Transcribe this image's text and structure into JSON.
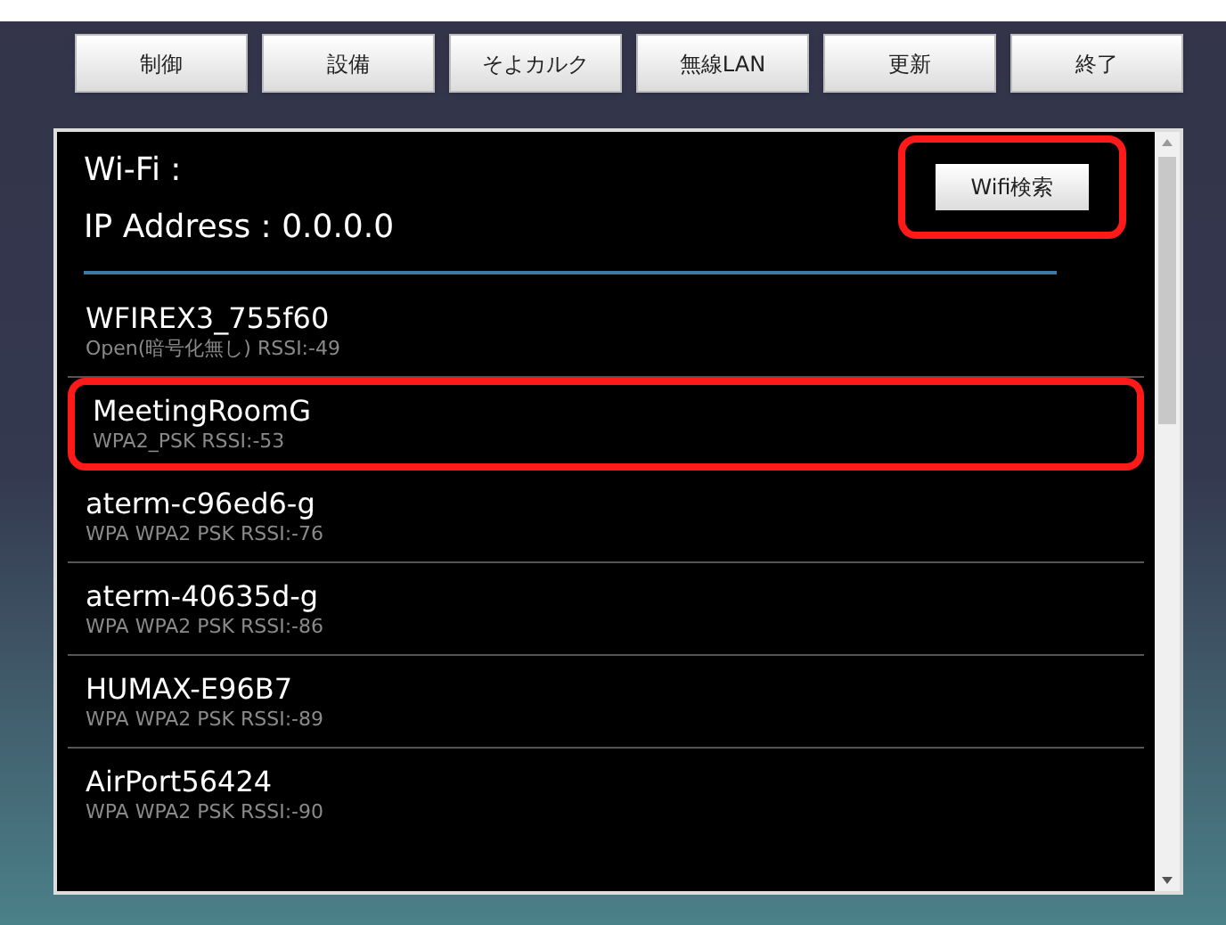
{
  "menu_buttons": [
    {
      "label": "制御"
    },
    {
      "label": "設備"
    },
    {
      "label": "そよカルク"
    },
    {
      "label": "無線LAN"
    },
    {
      "label": "更新"
    },
    {
      "label": "終了"
    }
  ],
  "wifi_label": "Wi-Fi :",
  "ip_address": "IP Address : 0.0.0.0",
  "scan_button": {
    "label": "Wifi検索",
    "highlighted": true
  },
  "networks": [
    {
      "name": "WFIREX3_755f60",
      "detail": "Open(暗号化無し) RSSI:-49",
      "highlighted": false
    },
    {
      "name": "MeetingRoomG",
      "detail": "WPA2_PSK RSSI:-53",
      "highlighted": true
    },
    {
      "name": "aterm-c96ed6-g",
      "detail": "WPA WPA2 PSK RSSI:-76",
      "highlighted": false
    },
    {
      "name": "aterm-40635d-g",
      "detail": "WPA WPA2 PSK RSSI:-86",
      "highlighted": false
    },
    {
      "name": "HUMAX-E96B7",
      "detail": "WPA WPA2 PSK RSSI:-89",
      "highlighted": false
    },
    {
      "name": "AirPort56424",
      "detail": "WPA WPA2 PSK RSSI:-90",
      "highlighted": false
    }
  ]
}
